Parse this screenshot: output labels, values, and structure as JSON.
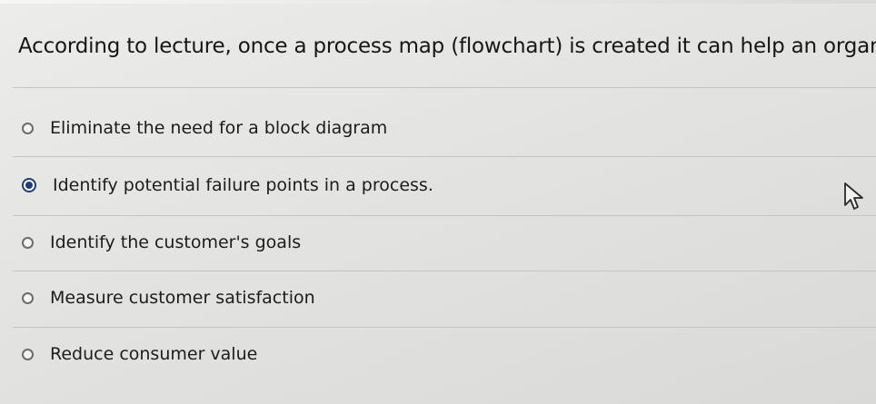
{
  "question": {
    "text": "According to lecture, once a process map (flowchart) is created it can help an organiz"
  },
  "options": [
    {
      "label": "Eliminate the need for a block diagram",
      "selected": false
    },
    {
      "label": "Identify potential failure points in a process.",
      "selected": true
    },
    {
      "label": "Identify the customer's goals",
      "selected": false
    },
    {
      "label": "Measure customer satisfaction",
      "selected": false
    },
    {
      "label": "Reduce consumer value",
      "selected": false
    }
  ],
  "cursor": {
    "icon": "mouse-pointer-icon"
  },
  "colors": {
    "selected_radio": "#1d3d78",
    "background": "#e3e3e1"
  }
}
